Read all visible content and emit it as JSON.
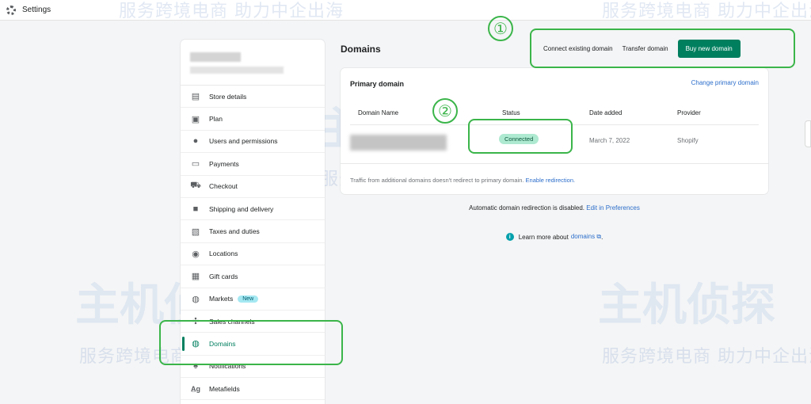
{
  "header": {
    "title": "Settings"
  },
  "sidebar": {
    "items": [
      {
        "label": "Store details",
        "icon": "store-icon"
      },
      {
        "label": "Plan",
        "icon": "plan-icon"
      },
      {
        "label": "Users and permissions",
        "icon": "user-icon"
      },
      {
        "label": "Payments",
        "icon": "payments-icon"
      },
      {
        "label": "Checkout",
        "icon": "cart-icon"
      },
      {
        "label": "Shipping and delivery",
        "icon": "truck-icon"
      },
      {
        "label": "Taxes and duties",
        "icon": "tax-icon"
      },
      {
        "label": "Locations",
        "icon": "location-pin-icon"
      },
      {
        "label": "Gift cards",
        "icon": "gift-icon"
      },
      {
        "label": "Markets",
        "icon": "globe-icon",
        "badge": "New"
      },
      {
        "label": "Sales channels",
        "icon": "channels-icon"
      },
      {
        "label": "Domains",
        "icon": "domain-globe-icon",
        "active": true
      },
      {
        "label": "Notifications",
        "icon": "bell-icon"
      },
      {
        "label": "Metafields",
        "icon": "metafields-icon"
      }
    ]
  },
  "main": {
    "title": "Domains",
    "actions": {
      "connect": "Connect existing domain",
      "transfer": "Transfer domain",
      "buy": "Buy new domain"
    },
    "primary_card": {
      "title": "Primary domain",
      "change_link": "Change primary domain",
      "columns": [
        "Domain Name",
        "Status",
        "Date added",
        "Provider"
      ],
      "row": {
        "status": "Connected",
        "date_added": "March 7, 2022",
        "provider": "Shopify"
      },
      "footer_text": "Traffic from additional domains doesn't redirect to primary domain.",
      "footer_link": "Enable redirection."
    },
    "redirect_note": "Automatic domain redirection is disabled.",
    "redirect_link": "Edit in Preferences",
    "learn_text": "Learn more about",
    "learn_link": "domains",
    "learn_suffix": "."
  },
  "annotations": {
    "one": "①",
    "two": "②"
  },
  "watermark": {
    "slogan": "服务跨境电商  助力中企出海",
    "brand": "主机侦探"
  },
  "colors": {
    "accent": "#007f5f",
    "link": "#2c6ecb",
    "annotation": "#3bb54a",
    "badge_connected": "#aee9d1"
  }
}
